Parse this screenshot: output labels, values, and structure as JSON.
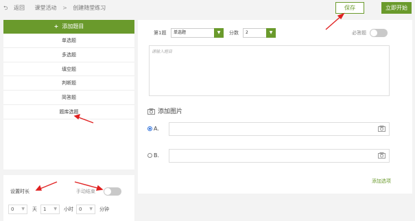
{
  "breadcrumb": {
    "back": "返回",
    "level1": "课堂活动",
    "sep": ">",
    "level2": "创建随堂练习"
  },
  "toolbar": {
    "save_label": "保存",
    "start_label": "立即开始"
  },
  "sidebar": {
    "add_label": "添加题目",
    "plus": "+",
    "items": [
      {
        "label": "单选题"
      },
      {
        "label": "多选题"
      },
      {
        "label": "填空题"
      },
      {
        "label": "判断题"
      },
      {
        "label": "简答题"
      },
      {
        "label": "题库选题"
      }
    ]
  },
  "duration": {
    "label": "设置时长",
    "manual_end_label": "手动结束",
    "days_value": "0",
    "days_unit": "天",
    "hours_value": "1",
    "hours_unit": "小时",
    "minutes_value": "0",
    "minutes_unit": "分钟"
  },
  "question": {
    "number_label": "第1题",
    "type_value": "单选题",
    "score_label": "分数",
    "score_value": "2",
    "required_label": "必答题",
    "content_placeholder": "请输入题目",
    "add_image_label": "添加图片",
    "options": [
      {
        "label": "A.",
        "selected": true
      },
      {
        "label": "B.",
        "selected": false
      }
    ],
    "add_option_label": "添加选项"
  },
  "colors": {
    "accent": "#6a9a2c",
    "annotation": "#e02020",
    "radio": "#3273dc"
  }
}
